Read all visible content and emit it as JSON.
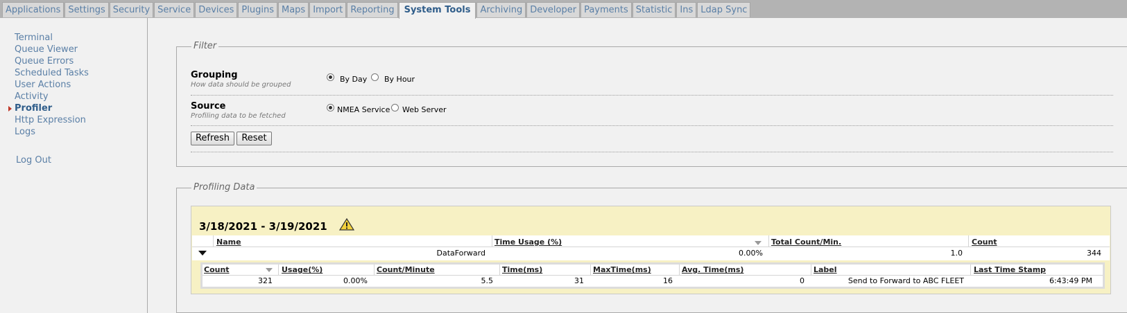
{
  "tabs": [
    "Applications",
    "Settings",
    "Security",
    "Service",
    "Devices",
    "Plugins",
    "Maps",
    "Import",
    "Reporting",
    "System Tools",
    "Archiving",
    "Developer",
    "Payments",
    "Statistic",
    "Ins",
    "Ldap Sync"
  ],
  "active_tab": "System Tools",
  "sidebar": {
    "items": [
      "Terminal",
      "Queue Viewer",
      "Queue Errors",
      "Scheduled Tasks",
      "User Actions",
      "Activity",
      "Profiler",
      "Http Expression",
      "Logs"
    ],
    "active_item": "Profiler",
    "logout": "Log Out"
  },
  "filter": {
    "legend": "Filter",
    "grouping": {
      "title": "Grouping",
      "desc": "How data should be grouped",
      "options": [
        "By Day",
        "By Hour"
      ],
      "selected": "By Day"
    },
    "source": {
      "title": "Source",
      "desc": "Profiling data to be fetched",
      "options": [
        "NMEA Service",
        "Web Server"
      ],
      "selected": "NMEA Service"
    },
    "refresh_label": "Refresh",
    "reset_label": "Reset"
  },
  "profiling": {
    "legend": "Profiling Data",
    "date_range": "3/18/2021 - 3/19/2021",
    "columns": [
      "Name",
      "Time Usage (%)",
      "Total Count/Min.",
      "Count"
    ],
    "row": {
      "name": "DataForward",
      "time_usage": "0.00%",
      "total_count_min": "1.0",
      "count": "344"
    },
    "sub_columns": [
      "Count",
      "Usage(%)",
      "Count/Minute",
      "Time(ms)",
      "MaxTime(ms)",
      "Avg. Time(ms)",
      "Label",
      "Last Time Stamp"
    ],
    "sub_row": {
      "count": "321",
      "usage": "0.00%",
      "count_minute": "5.5",
      "time_ms": "31",
      "maxtime_ms": "16",
      "avg_time_ms": "0",
      "label": "Send to Forward to ABC FLEET",
      "last_time_stamp": "6:43:49 PM"
    }
  },
  "icons": {
    "warning": "warning-icon",
    "sort": "sort-desc-icon",
    "expand": "collapse-toggle-icon"
  }
}
